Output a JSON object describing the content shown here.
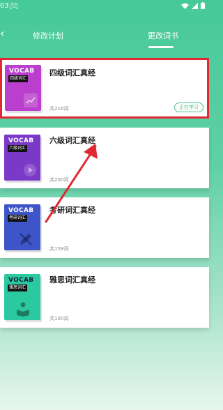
{
  "status_bar": {
    "time": "03",
    "game_icon": "gamepad-icon",
    "wifi_icon": "wifi-icon",
    "signal_icon": "signal-icon",
    "battery_icon": "battery-icon"
  },
  "header": {
    "back_icon": "chevron-left-icon",
    "tabs": [
      {
        "label": "修改计划",
        "active": false
      },
      {
        "label": "更改词书",
        "active": true
      }
    ]
  },
  "books": [
    {
      "cover_title": "VOCAB",
      "cover_tag": "四级词汇",
      "name": "四级词汇真经",
      "count": "共216词",
      "status": "正在学习",
      "cover_color": "#bb3fce",
      "emblem": "trend-chart-icon",
      "selected": true
    },
    {
      "cover_title": "VOCAB",
      "cover_tag": "六级词汇",
      "name": "六级词汇真经",
      "count": "共200词",
      "status": "",
      "cover_color": "#7b39c7",
      "emblem": "play-icon",
      "selected": false
    },
    {
      "cover_title": "VOCAB",
      "cover_tag": "考研词汇",
      "name": "考研词汇真经",
      "count": "共159词",
      "status": "",
      "cover_color": "#3e55c9",
      "emblem": "pencil-icon",
      "selected": false
    },
    {
      "cover_title": "VOCAB",
      "cover_tag": "雅思词汇",
      "name": "雅思词汇真经",
      "count": "共100词",
      "status": "",
      "cover_color": "#2bc9a0",
      "emblem": "reader-icon",
      "selected": false
    }
  ],
  "annotation": {
    "arrow_color": "#e02930",
    "box_color": "#e02930"
  }
}
